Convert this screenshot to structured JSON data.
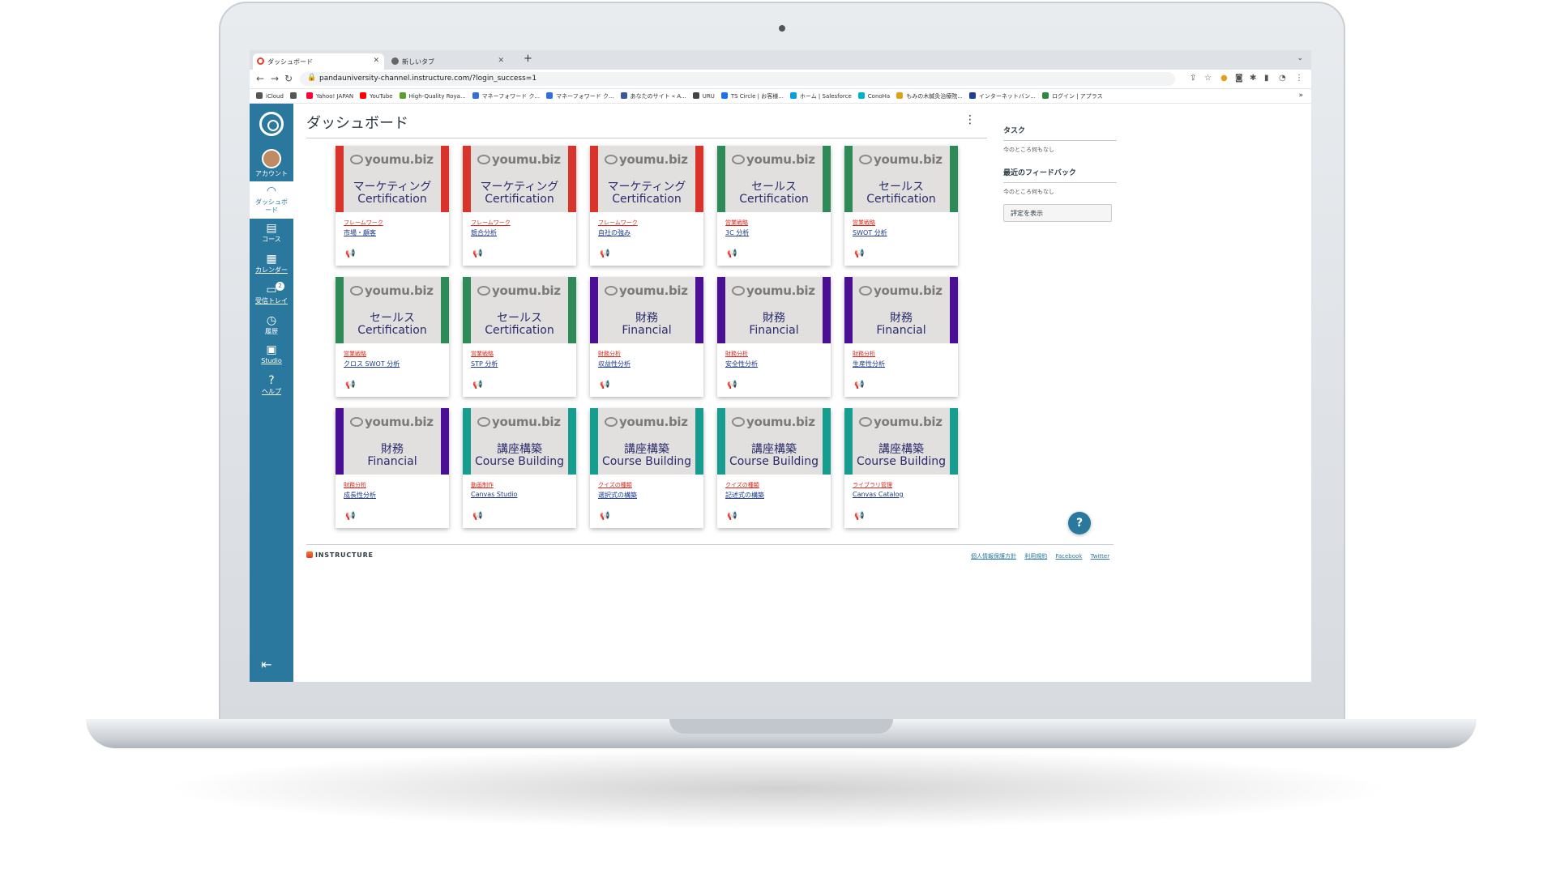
{
  "browser": {
    "tabs": [
      {
        "label": "ダッシュボード",
        "active": true
      },
      {
        "label": "新しいタブ",
        "active": false
      }
    ],
    "new_tab_label": "+",
    "url": "pandauniversity-channel.instructure.com/?login_success=1",
    "bookmarks": [
      {
        "label": "iCloud",
        "color": "#555555"
      },
      {
        "label": "",
        "color": "#555555"
      },
      {
        "label": "Yahoo! JAPAN",
        "color": "#ff0033"
      },
      {
        "label": "YouTube",
        "color": "#ff0000"
      },
      {
        "label": "High-Quality Roya...",
        "color": "#5a9e2f"
      },
      {
        "label": "マネーフォワード ク...",
        "color": "#2f6fd6"
      },
      {
        "label": "マネーフォワード ク...",
        "color": "#2f6fd6"
      },
      {
        "label": "あなたのサイト « A...",
        "color": "#3b5998"
      },
      {
        "label": "URU",
        "color": "#444444"
      },
      {
        "label": "TS Circle | お客様...",
        "color": "#1a73e8"
      },
      {
        "label": "ホーム | Salesforce",
        "color": "#00a1e0"
      },
      {
        "label": "ConoHa",
        "color": "#00b3c7"
      },
      {
        "label": "もみの木鍼灸治療院...",
        "color": "#e0a020"
      },
      {
        "label": "インターネットバン...",
        "color": "#1c3f94"
      },
      {
        "label": "ログイン | アプラス",
        "color": "#2b8a3e"
      }
    ]
  },
  "nav": {
    "items": [
      {
        "label": "アカウント",
        "icon": "avatar"
      },
      {
        "label": "ダッシュボード",
        "icon": "dashboard-icon"
      },
      {
        "label": "コース",
        "icon": "courses-icon"
      },
      {
        "label": "カレンダー",
        "icon": "calendar-icon"
      },
      {
        "label": "受信トレイ",
        "icon": "inbox-icon",
        "badge": "2"
      },
      {
        "label": "履歴",
        "icon": "history-icon"
      },
      {
        "label": "Studio",
        "icon": "studio-icon"
      },
      {
        "label": "ヘルプ",
        "icon": "help-icon"
      }
    ]
  },
  "page": {
    "title": "ダッシュボード"
  },
  "colors": {
    "red": "#d9342b",
    "green": "#2e8b57",
    "purple": "#4b0f96",
    "teal": "#179c90"
  },
  "brand_text": "youmu.biz",
  "cards": [
    {
      "t1": "マーケティング",
      "t2": "Certification",
      "cat": "フレームワーク",
      "name": "市場・顧客",
      "color": "red"
    },
    {
      "t1": "マーケティング",
      "t2": "Certification",
      "cat": "フレームワーク",
      "name": "競合分析",
      "color": "red"
    },
    {
      "t1": "マーケティング",
      "t2": "Certification",
      "cat": "フレームワーク",
      "name": "自社の強み",
      "color": "red"
    },
    {
      "t1": "セールス",
      "t2": "Certification",
      "cat": "営業戦略",
      "name": "3C 分析",
      "color": "green"
    },
    {
      "t1": "セールス",
      "t2": "Certification",
      "cat": "営業戦略",
      "name": "SWOT 分析",
      "color": "green"
    },
    {
      "t1": "セールス",
      "t2": "Certification",
      "cat": "営業戦略",
      "name": "クロス SWOT 分析",
      "color": "green"
    },
    {
      "t1": "セールス",
      "t2": "Certification",
      "cat": "営業戦略",
      "name": "STP 分析",
      "color": "green"
    },
    {
      "t1": "財務",
      "t2": "Financial",
      "cat": "財務分析",
      "name": "収益性分析",
      "color": "purple"
    },
    {
      "t1": "財務",
      "t2": "Financial",
      "cat": "財務分析",
      "name": "安全性分析",
      "color": "purple"
    },
    {
      "t1": "財務",
      "t2": "Financial",
      "cat": "財務分析",
      "name": "生産性分析",
      "color": "purple"
    },
    {
      "t1": "財務",
      "t2": "Financial",
      "cat": "財務分析",
      "name": "成長性分析",
      "color": "purple"
    },
    {
      "t1": "講座構築",
      "t2": "Course Building",
      "cat": "動画制作",
      "name": "Canvas Studio",
      "color": "teal"
    },
    {
      "t1": "講座構築",
      "t2": "Course Building",
      "cat": "クイズの種類",
      "name": "選択式の構築",
      "color": "teal"
    },
    {
      "t1": "講座構築",
      "t2": "Course Building",
      "cat": "クイズの種類",
      "name": "記述式の構築",
      "color": "teal"
    },
    {
      "t1": "講座構築",
      "t2": "Course Building",
      "cat": "ライブラリ管理",
      "name": "Canvas Catalog",
      "color": "teal"
    }
  ],
  "sidebar": {
    "todo_title": "タスク",
    "todo_empty": "今のところ何もなし",
    "feedback_title": "最近のフィードバック",
    "feedback_empty": "今のところ何もなし",
    "grades_button": "評定を表示"
  },
  "footer": {
    "brand": "INSTRUCTURE",
    "links": [
      "個人情報保護方針",
      "利用規約",
      "Facebook",
      "Twitter"
    ]
  }
}
